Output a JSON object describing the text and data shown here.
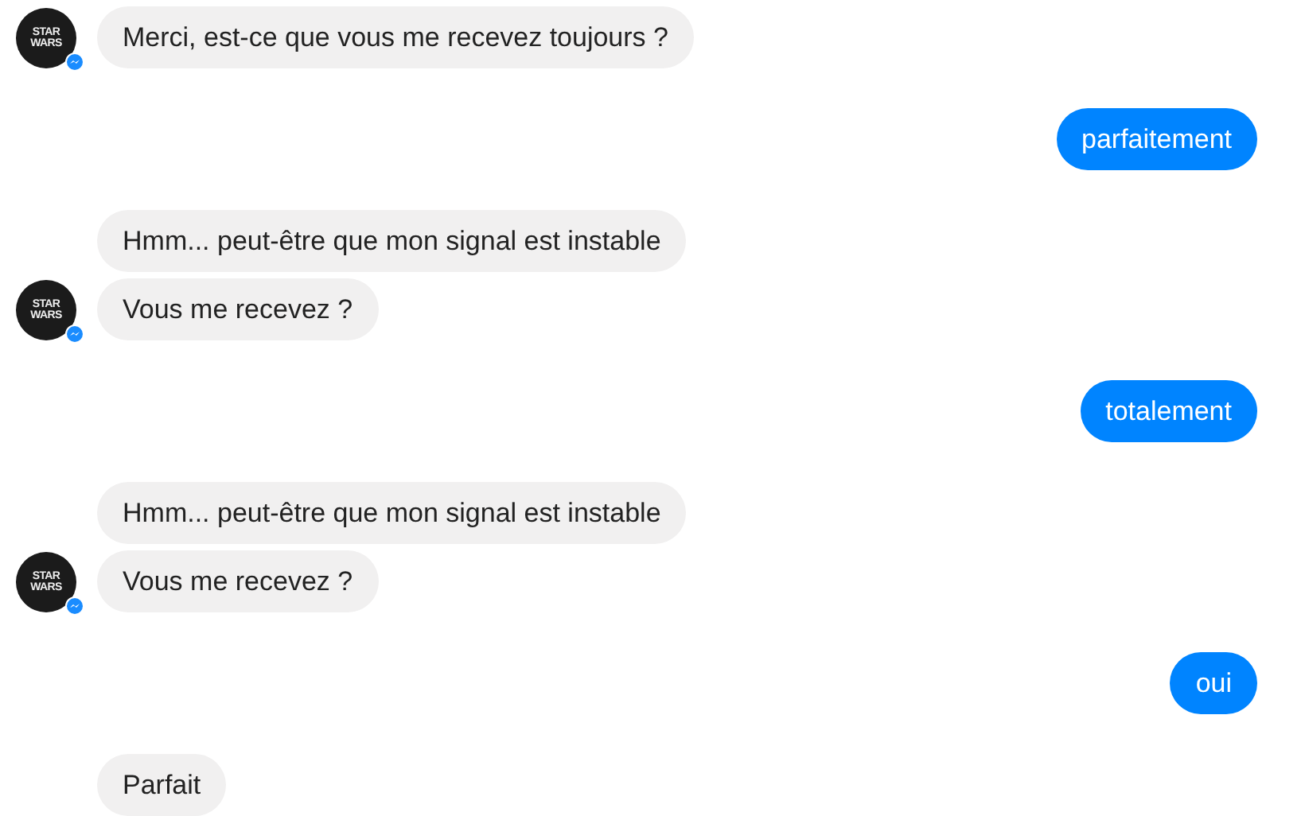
{
  "groups": [
    {
      "kind": "incoming",
      "avatar": {
        "logo": "STAR WARS"
      },
      "messages": [
        "Merci, est-ce que vous me recevez toujours ?"
      ]
    },
    {
      "kind": "outgoing",
      "messages": [
        "parfaitement"
      ]
    },
    {
      "kind": "incoming",
      "avatar": {
        "logo": "STAR WARS"
      },
      "messages": [
        "Hmm... peut-être que mon signal est instable",
        "Vous me recevez ?"
      ]
    },
    {
      "kind": "outgoing",
      "messages": [
        "totalement"
      ]
    },
    {
      "kind": "incoming",
      "avatar": {
        "logo": "STAR WARS"
      },
      "messages": [
        "Hmm... peut-être que mon signal est instable",
        "Vous me recevez ?"
      ]
    },
    {
      "kind": "outgoing",
      "messages": [
        "oui"
      ]
    },
    {
      "kind": "incoming",
      "messages": [
        "Parfait"
      ]
    }
  ]
}
